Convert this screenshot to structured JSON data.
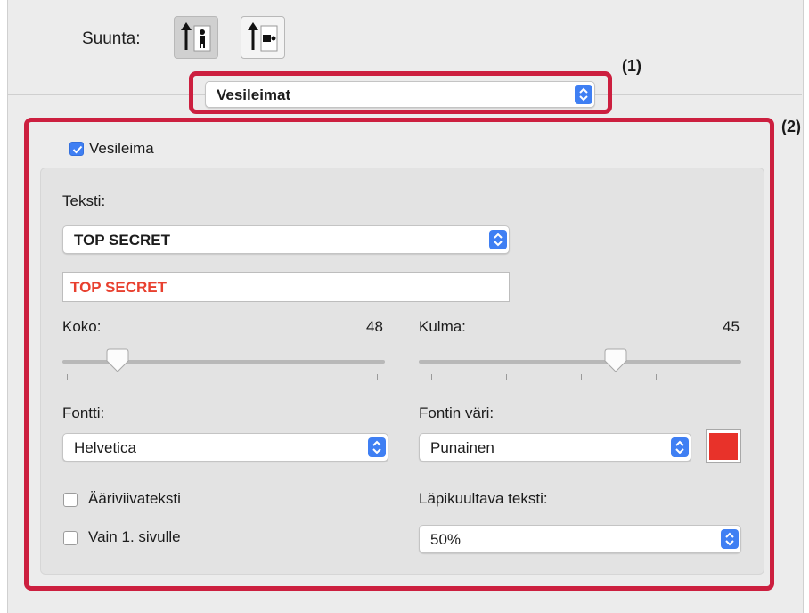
{
  "orientation": {
    "label": "Suunta:",
    "options": [
      {
        "name": "portrait",
        "selected": true
      },
      {
        "name": "landscape",
        "selected": false
      }
    ]
  },
  "annotations": {
    "callout1": "(1)",
    "callout2": "(2)",
    "color": "#cc1f3f"
  },
  "panel_select": {
    "value": "Vesileimat"
  },
  "watermark": {
    "enabled": true,
    "checkbox_label": "Vesileima",
    "text_label": "Teksti:",
    "text_select": "TOP SECRET",
    "text_field": "TOP SECRET",
    "size": {
      "label": "Koko:",
      "value": "48",
      "fraction": 0.17
    },
    "angle": {
      "label": "Kulma:",
      "value": "45",
      "fraction": 0.61
    },
    "font": {
      "label": "Fontti:",
      "value": "Helvetica"
    },
    "font_color": {
      "label": "Fontin väri:",
      "value": "Punainen",
      "swatch": "#e8322a"
    },
    "outline": {
      "label": "Ääriviivateksti",
      "checked": false
    },
    "first_page": {
      "label": "Vain 1. sivulle",
      "checked": false
    },
    "transparency": {
      "label": "Läpikuultava teksti:",
      "value": "50%"
    }
  },
  "colors": {
    "accent": "#3f7ff3",
    "preview_text": "#e8402f"
  }
}
